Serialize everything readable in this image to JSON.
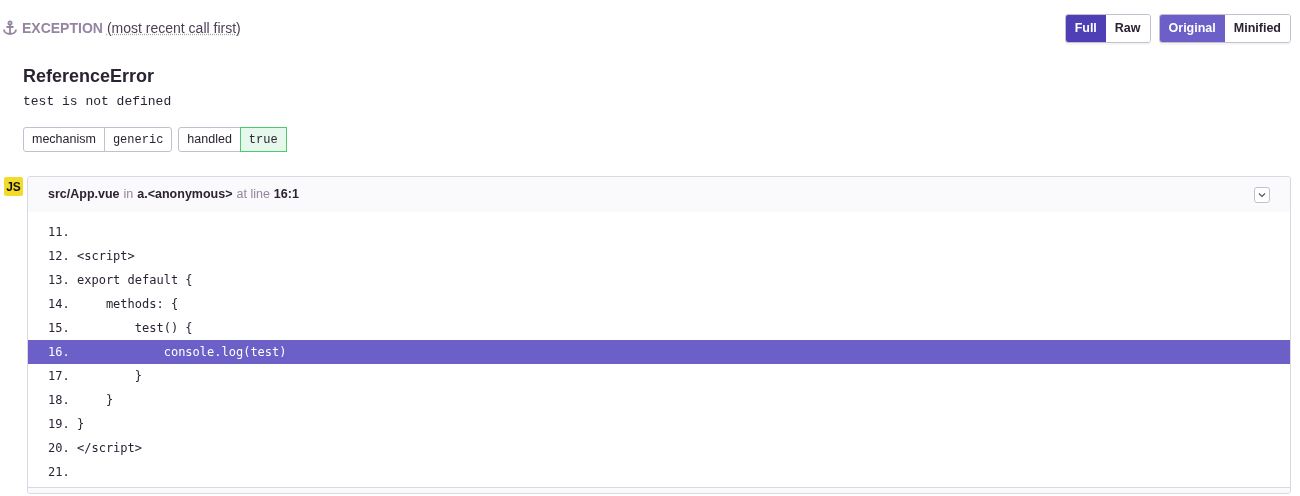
{
  "header": {
    "title": "EXCEPTION",
    "subtitle": "(most recent call first)"
  },
  "view_toggle": [
    {
      "label": "Full",
      "selected": true
    },
    {
      "label": "Raw",
      "selected": false
    }
  ],
  "source_toggle": [
    {
      "label": "Original",
      "selected": true
    },
    {
      "label": "Minified",
      "selected": false
    }
  ],
  "exception": {
    "type": "ReferenceError",
    "message": "test is not defined"
  },
  "tags": [
    {
      "key": "mechanism",
      "value": "generic",
      "kind": "neutral"
    },
    {
      "key": "handled",
      "value": "true",
      "kind": "success"
    }
  ],
  "frame": {
    "platform": "JS",
    "file": "src/App.vue",
    "in_label": "in",
    "function": "a.<anonymous>",
    "at_label": "at line",
    "location": "16:1",
    "expanded": true,
    "lines": [
      {
        "number": "11.",
        "selected": false
      },
      {
        "number": "12.",
        "code": "<script>",
        "selected": false
      },
      {
        "number": "13.",
        "code": "export default {",
        "selected": false
      },
      {
        "number": "14.",
        "code": "    methods: {",
        "selected": false
      },
      {
        "number": "15.",
        "code": "        test() {",
        "selected": false
      },
      {
        "number": "16.",
        "code": "            console.log(test)",
        "selected": true
      },
      {
        "number": "17.",
        "code": "        }",
        "selected": false
      },
      {
        "number": "18.",
        "code": "    }",
        "selected": false
      },
      {
        "number": "19.",
        "code": "}",
        "selected": false
      },
      {
        "number": "20.",
        "code": "</script>",
        "selected": false
      },
      {
        "number": "21.",
        "selected": false
      }
    ]
  }
}
